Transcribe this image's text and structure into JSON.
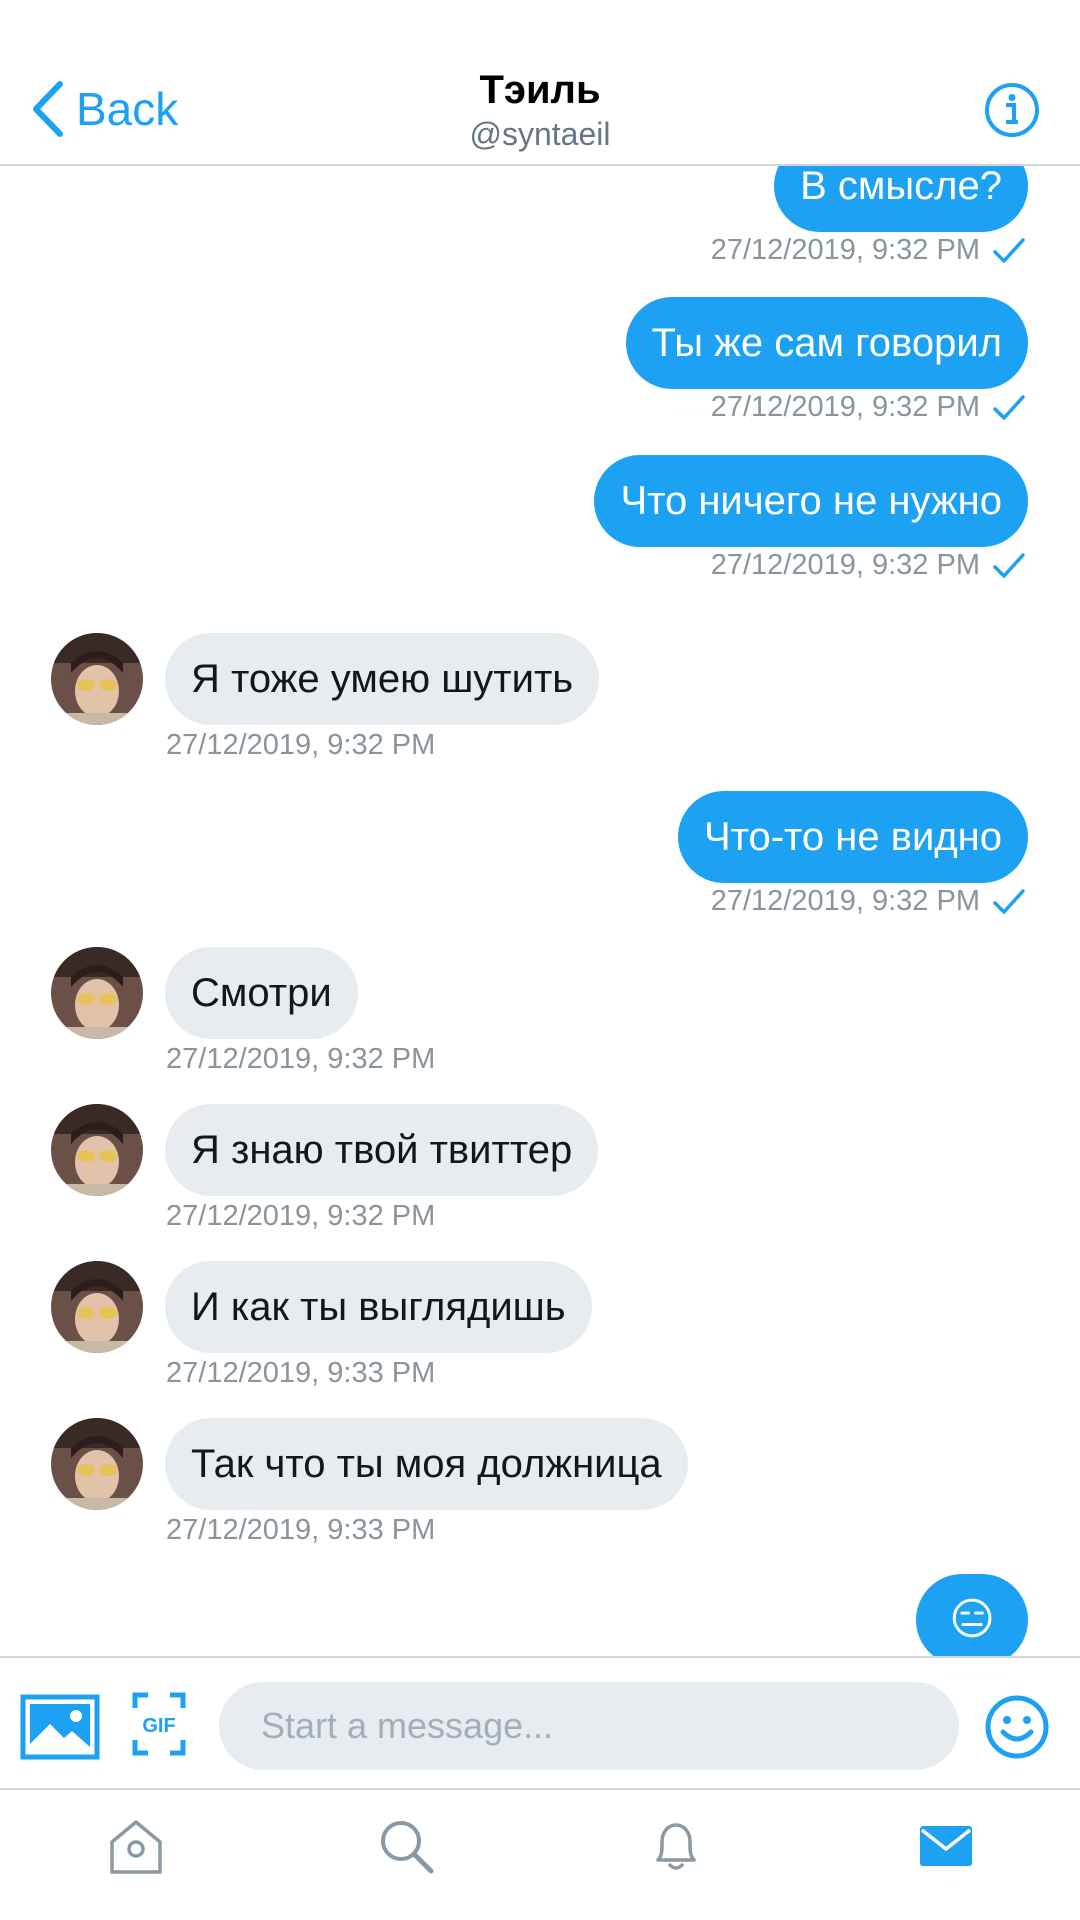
{
  "header": {
    "back_label": "Back",
    "title": "Тэиль",
    "handle": "@syntaeil"
  },
  "messages": [
    {
      "direction": "out",
      "text": "В смысле?",
      "timestamp": "27/12/2019, 9:32 PM",
      "read": true
    },
    {
      "direction": "out",
      "text": "Ты же сам говорил",
      "timestamp": "27/12/2019, 9:32 PM",
      "read": true
    },
    {
      "direction": "out",
      "text": "Что ничего не нужно",
      "timestamp": "27/12/2019, 9:32 PM",
      "read": true
    },
    {
      "direction": "in",
      "text": "Я тоже умею шутить",
      "timestamp": "27/12/2019, 9:32 PM"
    },
    {
      "direction": "out",
      "text": "Что-то не видно",
      "timestamp": "27/12/2019, 9:32 PM",
      "read": true
    },
    {
      "direction": "in",
      "text": "Смотри",
      "timestamp": "27/12/2019, 9:32 PM"
    },
    {
      "direction": "in",
      "text": "Я знаю твой твиттер",
      "timestamp": "27/12/2019, 9:32 PM"
    },
    {
      "direction": "in",
      "text": "И как ты выглядишь",
      "timestamp": "27/12/2019, 9:33 PM"
    },
    {
      "direction": "in",
      "text": "Так что ты моя должница",
      "timestamp": "27/12/2019, 9:33 PM"
    },
    {
      "direction": "out",
      "text": "😑"
    }
  ],
  "composer": {
    "placeholder": "Start a message...",
    "value": "",
    "gif_label": "GIF"
  },
  "tabs": [
    {
      "name": "home",
      "icon": "home-icon",
      "active": false
    },
    {
      "name": "search",
      "icon": "search-icon",
      "active": false
    },
    {
      "name": "notifications",
      "icon": "bell-icon",
      "active": false
    },
    {
      "name": "messages",
      "icon": "mail-icon",
      "active": true
    }
  ],
  "colors": {
    "accent": "#1da1f2",
    "incoming_bubble": "#e6ecf0",
    "meta_text": "#8a949c",
    "inactive_icon": "#8899a6"
  }
}
